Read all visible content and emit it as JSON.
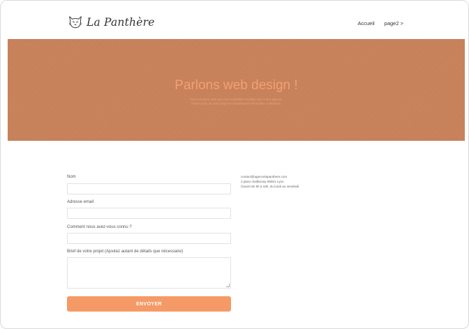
{
  "header": {
    "brand": "La Panthère",
    "logo_icon": "panther-head-icon",
    "nav": [
      {
        "label": "Accueil"
      },
      {
        "label": "page2 >"
      }
    ]
  },
  "hero": {
    "title": "Parlons web design !",
    "subtitle_line1": "Nous sommes ravis que vous souhaitiez travailler avec notre agence.",
    "subtitle_line2": "Parlez-nous de votre projet en remplissant le formulaire ci-dessous.",
    "background_color": "#c9825a",
    "title_color": "#f4a070"
  },
  "form": {
    "name_label": "Nom",
    "name_value": "",
    "email_label": "Adresse email",
    "email_value": "",
    "source_label": "Comment nous avez-vous connu ?",
    "source_value": "",
    "brief_label": "Brief de votre projet (Ajoutez autant de détails que nécessaire)",
    "brief_value": "",
    "submit_label": "ENVOYER",
    "submit_color": "#f59a66"
  },
  "contact": {
    "email": "contact@agencelapanthere.com",
    "address": "2 place Saitbonay 69001 Lyon",
    "hours": "Ouvert de 9h à 18h, du lundi au vendredi"
  }
}
